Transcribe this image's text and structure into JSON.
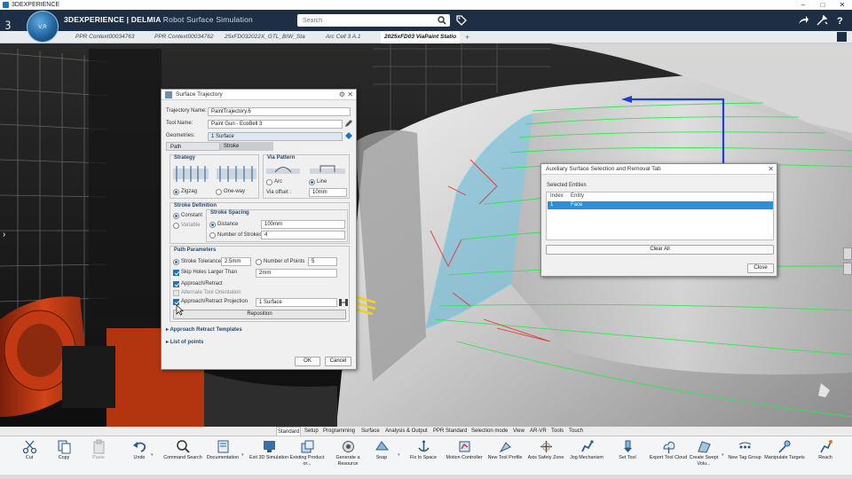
{
  "os_window": {
    "title": "3DEXPERIENCE"
  },
  "app": {
    "brand": "3DEXPERIENCE | DELMIA",
    "app_name": "Robot Surface Simulation",
    "compass_label": "V,R"
  },
  "search": {
    "placeholder": "Search"
  },
  "doc_tabs": [
    "PPR Context00034763",
    "PPR Context00034762",
    "25xFD032022X_GTL_BIW_Sta",
    "Arc Cell 3 A.1",
    "2025xFD03 ViaPaint Statio"
  ],
  "traj_dialog": {
    "title": "Surface Trajectory",
    "trajectory_name_label": "Trajectory Name:",
    "trajectory_name": "PaintTrajectory.6",
    "tool_name_label": "Tool Name:",
    "tool_name": "Paint Gun - EcoBell 3",
    "geometries_label": "Geometries:",
    "geometries": "1 Surface",
    "tab_path": "Path",
    "tab_stroke": "Stroke",
    "strategy": {
      "title": "Strategy",
      "zigzag": "Zigzag",
      "oneway": "One-way",
      "selected": "Zigzag"
    },
    "via_pattern": {
      "title": "Via Pattern",
      "arc": "Arc",
      "line": "Line",
      "selected": "Line",
      "via_offset_label": "Via offset :",
      "via_offset": "10mm"
    },
    "stroke_definition": {
      "title": "Stroke Definition",
      "constant": "Constant",
      "variable": "Variable",
      "selected": "Constant"
    },
    "stroke_spacing": {
      "title": "Stroke Spacing",
      "distance_label": "Distance",
      "distance": "100mm",
      "num_strokes_label": "Number of Strokes",
      "num_strokes": "4",
      "selected": "Distance"
    },
    "path_parameters": {
      "title": "Path Parameters",
      "stroke_tolerance_label": "Stroke Tolerance",
      "stroke_tolerance": "2.5mm",
      "num_points_label": "Number of Points",
      "num_points": "5",
      "skip_holes_label": "Skip Holes Larger Than",
      "skip_holes": "2mm",
      "approach_retract": "Approach/Retract",
      "alternate_orientation": "Alternate Tool Orientation",
      "approach_projection_label": "Approach/Retract Projection",
      "approach_projection": "1 Surface",
      "reposition": "Reposition"
    },
    "approach_templates": "Approach Retract Templates",
    "list_of_points": "List of points",
    "ok": "OK",
    "cancel": "Cancel"
  },
  "aux_dialog": {
    "title": "Auxiliary Surface Selection and Removal Tab",
    "selected_entities_label": "Selected Entities",
    "col_index": "Index",
    "col_entity": "Entity",
    "rows": [
      {
        "index": "1",
        "entity": "Face"
      }
    ],
    "clear_all": "Clear All",
    "close": "Close"
  },
  "ribbon_tabs": [
    "Standard",
    "Setup",
    "Programming",
    "Surface",
    "Analysis & Output",
    "PPR Standard",
    "Selection mode",
    "View",
    "AR-VR",
    "Tools",
    "Touch"
  ],
  "ribbon_active_tab": "Standard",
  "tools": [
    {
      "name": "cut",
      "label": "Cut",
      "icon": "scissors-icon"
    },
    {
      "name": "copy",
      "label": "Copy",
      "icon": "copy-icon"
    },
    {
      "name": "paste",
      "label": "Paste",
      "icon": "paste-icon"
    },
    {
      "name": "undo",
      "label": "Undo",
      "icon": "undo-icon"
    },
    {
      "name": "command-search",
      "label": "Command Search",
      "icon": "command-search-icon"
    },
    {
      "name": "documentation",
      "label": "Documentation",
      "icon": "book-icon"
    },
    {
      "name": "exit-3d-simulation",
      "label": "Exit 3D Simulation",
      "icon": "exit-icon"
    },
    {
      "name": "existing-product",
      "label": "Existing Product or...",
      "icon": "product-icon"
    },
    {
      "name": "generate-resource",
      "label": "Generate a Resource",
      "icon": "resource-icon"
    },
    {
      "name": "snap",
      "label": "Snap",
      "icon": "snap-icon"
    },
    {
      "name": "fix-in-space",
      "label": "Fix In Space",
      "icon": "anchor-icon"
    },
    {
      "name": "motion-controller",
      "label": "Motion Controller",
      "icon": "motion-icon"
    },
    {
      "name": "new-tool-profile",
      "label": "New Tool Profile",
      "icon": "tool-profile-icon"
    },
    {
      "name": "axis-safety-zone",
      "label": "Axis Safety Zone",
      "icon": "axis-icon"
    },
    {
      "name": "jog-mechanism",
      "label": "Jog Mechanism",
      "icon": "jog-icon"
    },
    {
      "name": "set-tool",
      "label": "Set Tool",
      "icon": "set-tool-icon"
    },
    {
      "name": "export-tool-cloud",
      "label": "Export Tool Cloud",
      "icon": "export-icon"
    },
    {
      "name": "create-swept-volume",
      "label": "Create Swept Volu...",
      "icon": "swept-volume-icon"
    },
    {
      "name": "new-tag-group",
      "label": "New Tag Group",
      "icon": "tag-group-icon"
    },
    {
      "name": "manipulate-targets",
      "label": "Manipulate Targets",
      "icon": "targets-icon"
    },
    {
      "name": "reach",
      "label": "Reach",
      "icon": "reach-icon"
    }
  ],
  "colors": {
    "header_bg": "#1e2f45",
    "accent": "#1b75bb",
    "selection": "#2d8fd5",
    "trajectory_green": "#2ee84a",
    "trajectory_red": "#e03b3b",
    "surface_cyan": "#4fc9f0"
  }
}
